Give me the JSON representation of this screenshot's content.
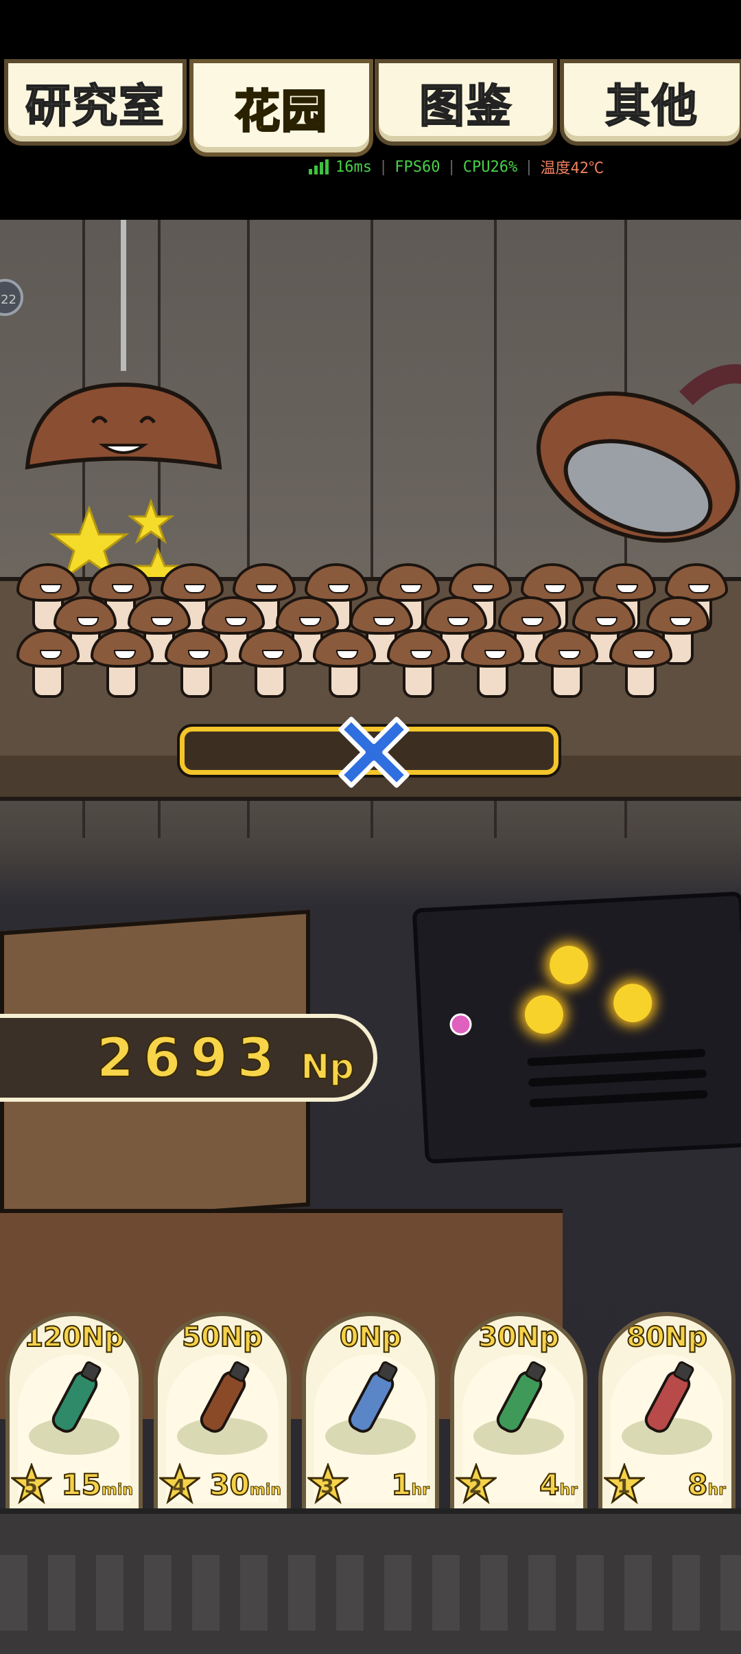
{
  "tabs": [
    {
      "label": "研究室",
      "active": false
    },
    {
      "label": "花园",
      "active": true
    },
    {
      "label": "图鉴",
      "active": false
    },
    {
      "label": "其他",
      "active": false
    }
  ],
  "perf": {
    "latency": "16ms",
    "fps": "FPS60",
    "cpu": "CPU26%",
    "temp": "温度42℃"
  },
  "side_badge": "22",
  "counter": {
    "value": "2693",
    "unit": "Np"
  },
  "growth_progress": 0,
  "cards": [
    {
      "price": "120Np",
      "stars": "5",
      "time": "15",
      "time_unit": "min",
      "bottle_color": "#2f8a6a",
      "icon": "cologne-bottle-icon"
    },
    {
      "price": "50Np",
      "stars": "4",
      "time": "30",
      "time_unit": "min",
      "bottle_color": "#8a4a28",
      "icon": "brown-vial-icon"
    },
    {
      "price": "0Np",
      "stars": "3",
      "time": "1",
      "time_unit": "hr",
      "bottle_color": "#5a86c8",
      "icon": "blue-vial-icon"
    },
    {
      "price": "30Np",
      "stars": "2",
      "time": "4",
      "time_unit": "hr",
      "bottle_color": "#3f9a5a",
      "icon": "green-vial-icon"
    },
    {
      "price": "80Np",
      "stars": "1",
      "time": "8",
      "time_unit": "hr",
      "bottle_color": "#b84a4a",
      "icon": "red-vial-icon"
    }
  ],
  "colors": {
    "accent_yellow": "#f6d24a",
    "card_bg": "#fbf4dc",
    "mushroom_cap": "#8a5a3c"
  }
}
